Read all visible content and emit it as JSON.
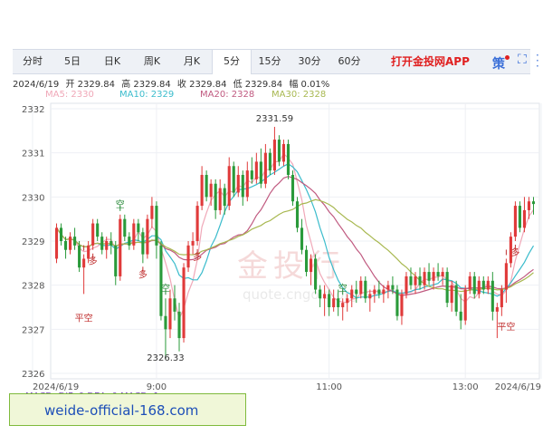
{
  "tabs": [
    {
      "label": "分时",
      "active": false
    },
    {
      "label": "5日",
      "active": false
    },
    {
      "label": "日K",
      "active": false
    },
    {
      "label": "周K",
      "active": false
    },
    {
      "label": "月K",
      "active": false
    },
    {
      "label": "5分",
      "active": true
    },
    {
      "label": "15分",
      "active": false
    },
    {
      "label": "30分",
      "active": false
    },
    {
      "label": "60分",
      "active": false
    }
  ],
  "promo": {
    "label": "打开金投网APP",
    "icon_text": "策",
    "color": "#e02020"
  },
  "icons": {
    "fullscreen": "fullscreen-icon",
    "more": "more-icon"
  },
  "info": {
    "date": "2024/6/19",
    "open": "开 2329.84",
    "high": "高 2329.84",
    "close": "收 2329.84",
    "low": "低 2329.84",
    "amp": "幅 0.01%"
  },
  "ma_labels": [
    {
      "text": "MA5: 2330",
      "color": "#f0a8b8"
    },
    {
      "text": "MA10: 2329",
      "color": "#3bbccc"
    },
    {
      "text": "MA20: 2328",
      "color": "#c05a80"
    },
    {
      "text": "MA30: 2328",
      "color": "#a8b850"
    }
  ],
  "watermark": {
    "text": "金投行",
    "sub": "quote.cngold.org"
  },
  "macd_partial": "MACD: DIF: 0   DEA: 0   MACD: 1",
  "banner": {
    "text": "weide-official-168.com"
  },
  "chart_data": {
    "type": "candlestick",
    "ylim": [
      2326,
      2332
    ],
    "y_ticks": [
      "2326",
      "2327",
      "2328",
      "2329",
      "2330",
      "2331",
      "2332"
    ],
    "x_tick_labels": [
      "2024/6/19",
      "9:00",
      "11:00",
      "13:00",
      "2024/6/19"
    ],
    "up_color": "#e03a3a",
    "down_color": "#2a9a3a",
    "annotations": {
      "high_label": "2331.59",
      "low_label": "2326.33"
    },
    "signals": [
      {
        "text": "空",
        "index": 14
      },
      {
        "text": "多",
        "index": 8
      },
      {
        "text": "平空",
        "index": 6
      },
      {
        "text": "多",
        "index": 19
      },
      {
        "text": "空",
        "index": 24
      },
      {
        "text": "多",
        "index": 31
      },
      {
        "text": "空",
        "index": 63
      },
      {
        "text": "多",
        "index": 101
      },
      {
        "text": "平空",
        "index": 99
      }
    ],
    "candles": [
      [
        2328.6,
        2329.4,
        2328.5,
        2329.3
      ],
      [
        2329.3,
        2329.4,
        2328.9,
        2329.0
      ],
      [
        2329.0,
        2329.1,
        2328.6,
        2328.8
      ],
      [
        2328.8,
        2329.2,
        2328.7,
        2329.1
      ],
      [
        2329.1,
        2329.3,
        2328.8,
        2328.9
      ],
      [
        2328.9,
        2329.0,
        2328.3,
        2328.4
      ],
      [
        2328.4,
        2328.7,
        2327.8,
        2328.6
      ],
      [
        2328.6,
        2329.0,
        2328.5,
        2328.9
      ],
      [
        2328.9,
        2329.5,
        2328.8,
        2329.4
      ],
      [
        2329.4,
        2329.5,
        2329.0,
        2329.1
      ],
      [
        2329.1,
        2329.2,
        2328.7,
        2328.8
      ],
      [
        2328.8,
        2329.1,
        2328.6,
        2329.0
      ],
      [
        2329.0,
        2329.2,
        2328.7,
        2328.9
      ],
      [
        2328.9,
        2329.0,
        2328.0,
        2328.2
      ],
      [
        2328.2,
        2329.6,
        2328.1,
        2329.5
      ],
      [
        2329.5,
        2329.6,
        2329.0,
        2329.1
      ],
      [
        2329.1,
        2329.2,
        2328.8,
        2328.9
      ],
      [
        2328.9,
        2329.5,
        2328.8,
        2329.4
      ],
      [
        2329.4,
        2329.5,
        2329.0,
        2329.2
      ],
      [
        2329.2,
        2329.3,
        2328.5,
        2328.7
      ],
      [
        2328.7,
        2329.6,
        2328.6,
        2329.5
      ],
      [
        2329.5,
        2330.0,
        2329.3,
        2329.8
      ],
      [
        2329.8,
        2329.9,
        2328.6,
        2328.9
      ],
      [
        2328.9,
        2329.0,
        2327.2,
        2327.3
      ],
      [
        2327.3,
        2327.7,
        2326.33,
        2327.0
      ],
      [
        2327.0,
        2327.9,
        2326.8,
        2327.7
      ],
      [
        2327.7,
        2328.0,
        2327.2,
        2327.4
      ],
      [
        2327.4,
        2327.6,
        2326.5,
        2326.8
      ],
      [
        2326.8,
        2328.5,
        2326.7,
        2328.4
      ],
      [
        2328.4,
        2329.0,
        2328.3,
        2328.9
      ],
      [
        2328.9,
        2329.2,
        2328.7,
        2329.0
      ],
      [
        2329.0,
        2329.9,
        2328.9,
        2329.8
      ],
      [
        2329.8,
        2330.7,
        2329.7,
        2330.5
      ],
      [
        2330.5,
        2330.6,
        2329.9,
        2330.0
      ],
      [
        2330.0,
        2330.4,
        2329.8,
        2330.3
      ],
      [
        2330.3,
        2330.4,
        2329.5,
        2329.7
      ],
      [
        2329.7,
        2330.4,
        2329.6,
        2330.2
      ],
      [
        2330.2,
        2330.3,
        2329.6,
        2329.8
      ],
      [
        2329.8,
        2330.9,
        2329.7,
        2330.7
      ],
      [
        2330.7,
        2330.8,
        2330.0,
        2330.1
      ],
      [
        2330.1,
        2330.7,
        2330.0,
        2330.5
      ],
      [
        2330.5,
        2330.6,
        2329.8,
        2330.0
      ],
      [
        2330.0,
        2330.8,
        2329.9,
        2330.6
      ],
      [
        2330.6,
        2330.9,
        2330.3,
        2330.4
      ],
      [
        2330.4,
        2331.0,
        2330.3,
        2330.8
      ],
      [
        2330.8,
        2331.1,
        2330.2,
        2330.3
      ],
      [
        2330.3,
        2331.2,
        2330.2,
        2331.0
      ],
      [
        2331.0,
        2331.1,
        2330.5,
        2330.6
      ],
      [
        2330.6,
        2331.59,
        2330.5,
        2331.3
      ],
      [
        2331.3,
        2331.4,
        2330.7,
        2330.8
      ],
      [
        2330.8,
        2331.3,
        2330.7,
        2331.2
      ],
      [
        2331.2,
        2331.3,
        2330.4,
        2330.5
      ],
      [
        2330.5,
        2330.6,
        2329.8,
        2329.9
      ],
      [
        2329.9,
        2330.0,
        2329.2,
        2329.3
      ],
      [
        2329.3,
        2329.5,
        2328.7,
        2328.8
      ],
      [
        2328.8,
        2328.9,
        2328.2,
        2328.3
      ],
      [
        2328.3,
        2328.7,
        2328.0,
        2328.6
      ],
      [
        2328.6,
        2328.7,
        2327.8,
        2327.9
      ],
      [
        2327.9,
        2328.0,
        2327.5,
        2327.7
      ],
      [
        2327.7,
        2328.0,
        2327.3,
        2327.8
      ],
      [
        2327.8,
        2327.9,
        2327.3,
        2327.5
      ],
      [
        2327.5,
        2327.9,
        2327.4,
        2327.7
      ],
      [
        2327.7,
        2327.9,
        2327.3,
        2327.5
      ],
      [
        2327.5,
        2327.7,
        2327.2,
        2327.6
      ],
      [
        2327.6,
        2327.8,
        2327.4,
        2327.7
      ],
      [
        2327.7,
        2328.0,
        2327.5,
        2327.9
      ],
      [
        2327.9,
        2328.1,
        2327.6,
        2327.8
      ],
      [
        2327.8,
        2328.2,
        2327.7,
        2328.1
      ],
      [
        2328.1,
        2328.2,
        2327.6,
        2327.7
      ],
      [
        2327.7,
        2327.9,
        2327.4,
        2327.8
      ],
      [
        2327.8,
        2328.0,
        2327.6,
        2327.9
      ],
      [
        2327.9,
        2328.1,
        2327.7,
        2327.8
      ],
      [
        2327.8,
        2328.0,
        2327.6,
        2327.9
      ],
      [
        2327.9,
        2328.1,
        2327.7,
        2328.0
      ],
      [
        2328.0,
        2328.2,
        2327.8,
        2327.9
      ],
      [
        2327.9,
        2328.0,
        2327.2,
        2327.3
      ],
      [
        2327.3,
        2327.9,
        2327.1,
        2327.8
      ],
      [
        2327.8,
        2328.3,
        2327.7,
        2328.2
      ],
      [
        2328.2,
        2328.4,
        2327.9,
        2328.0
      ],
      [
        2328.0,
        2328.3,
        2327.8,
        2328.2
      ],
      [
        2328.2,
        2328.4,
        2327.9,
        2328.0
      ],
      [
        2328.0,
        2328.4,
        2327.9,
        2328.3
      ],
      [
        2328.3,
        2328.5,
        2328.0,
        2328.1
      ],
      [
        2328.1,
        2328.4,
        2327.9,
        2328.3
      ],
      [
        2328.3,
        2328.5,
        2328.1,
        2328.2
      ],
      [
        2328.2,
        2328.4,
        2328.0,
        2328.3
      ],
      [
        2328.3,
        2328.4,
        2327.5,
        2327.6
      ],
      [
        2327.6,
        2328.1,
        2327.4,
        2328.0
      ],
      [
        2328.0,
        2328.1,
        2327.3,
        2327.4
      ],
      [
        2327.4,
        2327.8,
        2327.0,
        2327.2
      ],
      [
        2327.2,
        2328.0,
        2327.1,
        2327.9
      ],
      [
        2327.9,
        2328.3,
        2327.8,
        2328.2
      ],
      [
        2328.2,
        2328.3,
        2327.7,
        2327.8
      ],
      [
        2327.8,
        2328.2,
        2327.7,
        2328.1
      ],
      [
        2328.1,
        2328.2,
        2327.8,
        2327.9
      ],
      [
        2327.9,
        2328.2,
        2327.8,
        2328.1
      ],
      [
        2328.1,
        2328.3,
        2327.2,
        2327.4
      ],
      [
        2327.4,
        2327.6,
        2326.8,
        2327.5
      ],
      [
        2327.5,
        2328.0,
        2327.3,
        2327.9
      ],
      [
        2327.9,
        2328.6,
        2327.6,
        2328.5
      ],
      [
        2328.5,
        2329.2,
        2328.4,
        2329.1
      ],
      [
        2329.1,
        2329.9,
        2329.0,
        2329.8
      ],
      [
        2329.8,
        2329.9,
        2329.2,
        2329.3
      ],
      [
        2329.3,
        2330.0,
        2329.2,
        2329.7
      ],
      [
        2329.7,
        2330.0,
        2329.5,
        2329.9
      ],
      [
        2329.9,
        2330.0,
        2329.6,
        2329.84
      ]
    ]
  }
}
